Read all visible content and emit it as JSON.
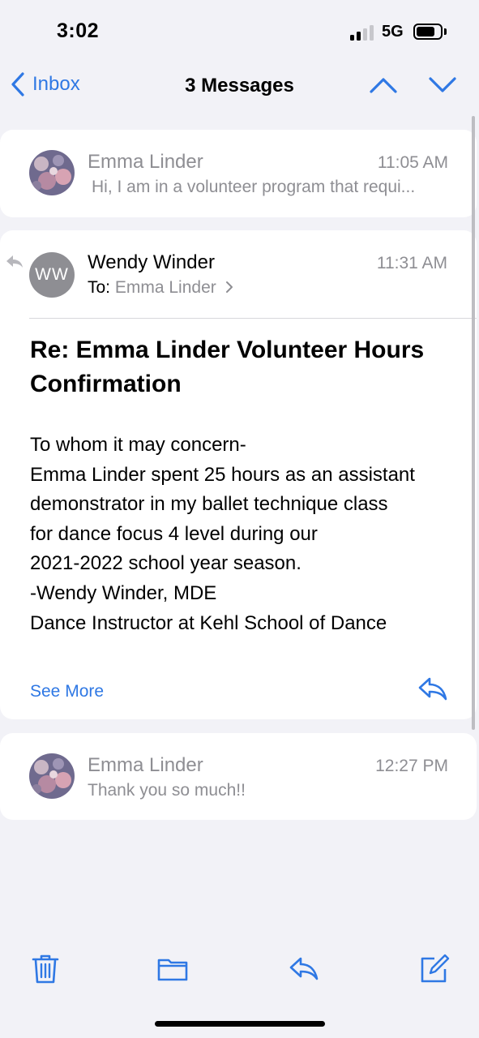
{
  "status_bar": {
    "time": "3:02",
    "network": "5G"
  },
  "navbar": {
    "back_label": "Inbox",
    "title": "3 Messages"
  },
  "messages": [
    {
      "sender": "Emma Linder",
      "time": "11:05 AM",
      "preview": "Hi, I am in a volunteer program that requi..."
    },
    {
      "sender": "Wendy Winder",
      "initials": "WW",
      "time": "11:31 AM",
      "to_label": "To:",
      "to_value": "Emma Linder",
      "subject": "Re: Emma Linder Volunteer Hours Confirmation",
      "body_lines": [
        "To whom it may concern-",
        "Emma Linder spent 25 hours as an assistant",
        "demonstrator in my ballet technique class",
        "for dance focus 4 level during our",
        "2021-2022 school year season.",
        "-Wendy Winder, MDE",
        "Dance Instructor at Kehl School of Dance"
      ],
      "see_more": "See More"
    },
    {
      "sender": "Emma Linder",
      "time": "12:27 PM",
      "preview": "Thank you so much!!"
    }
  ],
  "colors": {
    "accent": "#2f78e4",
    "secondary_text": "#8e8e93",
    "background": "#f2f2f7",
    "card": "#ffffff"
  },
  "icons": {
    "back": "chevron-left-icon",
    "previous": "chevron-up-icon",
    "next": "chevron-down-icon",
    "reply_indicator": "reply-arrow-icon",
    "reply": "reply-icon",
    "trash": "trash-icon",
    "folder": "folder-icon",
    "compose": "compose-icon"
  }
}
